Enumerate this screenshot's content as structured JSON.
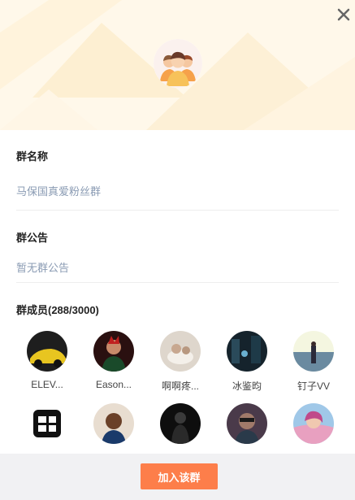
{
  "header": {
    "close_icon": "close-icon",
    "avatar_icon": "group-people-icon"
  },
  "group_name": {
    "label": "群名称",
    "value": "马保国真爱粉丝群"
  },
  "announcement": {
    "label": "群公告",
    "value": "暂无群公告"
  },
  "members": {
    "label": "群成员(288/3000)",
    "items": [
      {
        "name": "ELEV...",
        "color": "#2a2a2a"
      },
      {
        "name": "Eason...",
        "color": "#2b1a1a"
      },
      {
        "name": "啊啊疼...",
        "color": "#cfc8c0"
      },
      {
        "name": "冰鉴昀",
        "color": "#1d2a33"
      },
      {
        "name": "钉子VV",
        "color": "#8fb3c8"
      },
      {
        "name": "",
        "color": "#111111"
      },
      {
        "name": "",
        "color": "#b58a6a"
      },
      {
        "name": "",
        "color": "#141414"
      },
      {
        "name": "",
        "color": "#5a4a5a"
      },
      {
        "name": "",
        "color": "#d08ab0"
      }
    ]
  },
  "footer": {
    "join_label": "加入该群"
  },
  "colors": {
    "accent": "#fd7e4a",
    "header_bg": "#fff8ea",
    "value_text": "#8a9bb3"
  }
}
